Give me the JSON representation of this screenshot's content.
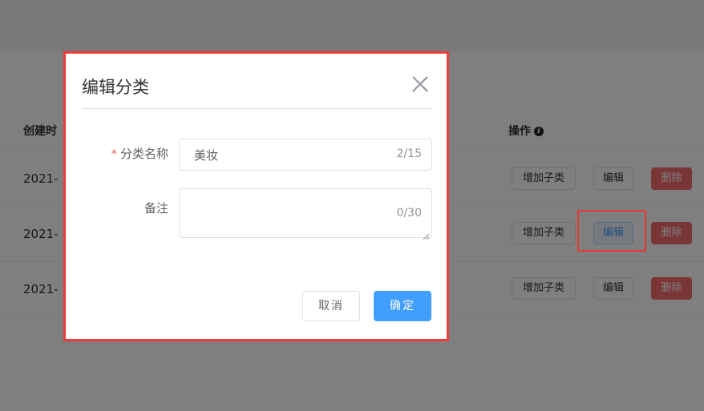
{
  "table": {
    "headers": {
      "created": "创建时",
      "actions": "操作"
    },
    "rows": [
      {
        "created": "2021-",
        "add_child": "增加子类",
        "edit": "编辑",
        "delete": "删除"
      },
      {
        "created": "2021-",
        "add_child": "增加子类",
        "edit": "编辑",
        "delete": "删除"
      },
      {
        "created": "2021-",
        "add_child": "增加子类",
        "edit": "编辑",
        "delete": "删除"
      }
    ],
    "info_glyph": "i"
  },
  "dialog": {
    "title": "编辑分类",
    "close_icon": "close-icon",
    "fields": {
      "name": {
        "required_mark": "*",
        "label": "分类名称",
        "value": "美妆",
        "count": "2/15"
      },
      "remark": {
        "label": "备注",
        "value": "",
        "count": "0/30"
      }
    },
    "buttons": {
      "cancel": "取消",
      "confirm": "确定"
    }
  },
  "colors": {
    "primary": "#409eff",
    "danger": "#f56c6c",
    "highlight_border": "#ee3b3b"
  }
}
